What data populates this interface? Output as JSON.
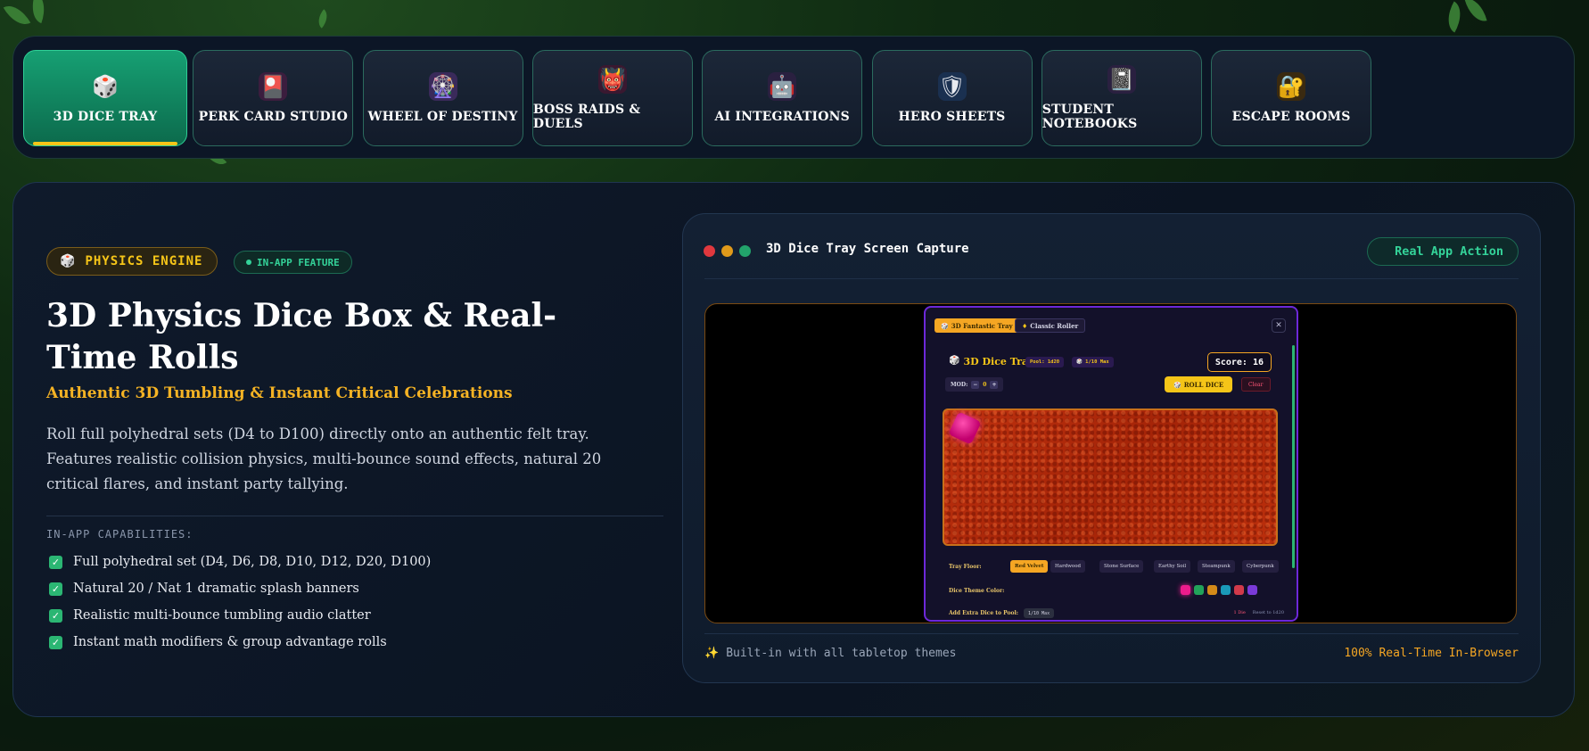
{
  "tabs": [
    {
      "label": "3D DICE TRAY",
      "icon": "dice-icon",
      "glyph": "🎲",
      "active": true
    },
    {
      "label": "PERK CARD STUDIO",
      "icon": "card-icon",
      "glyph": "🎴",
      "active": false
    },
    {
      "label": "WHEEL OF DESTINY",
      "icon": "wheel-icon",
      "glyph": "🎡",
      "active": false
    },
    {
      "label": "BOSS RAIDS & DUELS",
      "icon": "demon-icon",
      "glyph": "👹",
      "active": false
    },
    {
      "label": "AI INTEGRATIONS",
      "icon": "robot-icon",
      "glyph": "🤖",
      "active": false
    },
    {
      "label": "HERO SHEETS",
      "icon": "shield-icon",
      "glyph": "🛡",
      "active": false
    },
    {
      "label": "STUDENT NOTEBOOKS",
      "icon": "notebook-icon",
      "glyph": "📓",
      "active": false
    },
    {
      "label": "ESCAPE ROOMS",
      "icon": "padlock-icon",
      "glyph": "🔐",
      "active": false
    }
  ],
  "feature": {
    "badge_icon": "🎲",
    "badge": "PHYSICS ENGINE",
    "tag": "IN-APP FEATURE",
    "title": "3D Physics Dice Box & Real-Time Rolls",
    "subtitle": "Authentic 3D Tumbling & Instant Critical Celebrations",
    "description": "Roll full polyhedral sets (D4 to D100) directly onto an authentic felt tray. Features realistic collision physics, multi-bounce sound effects, natural 20 critical flares, and instant party tallying.",
    "capabilities_title": "IN-APP CAPABILITIES:",
    "capabilities": [
      "Full polyhedral set (D4, D6, D8, D10, D12, D20, D100)",
      "Natural 20 / Nat 1 dramatic splash banners",
      "Realistic multi-bounce tumbling audio clatter",
      "Instant math modifiers & group advantage rolls"
    ]
  },
  "capture": {
    "title": "3D Dice Tray Screen Capture",
    "live_label": "Real App Action",
    "footer_icon": "✨",
    "footer_left": "Built-in with all tabletop themes",
    "footer_right": "100% Real-Time In-Browser",
    "traffic_colors": [
      "#e0383e",
      "#e09a1a",
      "#22a36b"
    ]
  },
  "mini_app": {
    "tab_active": "3D Fantastic Tray",
    "tab_inactive": "Classic Roller",
    "tab_inactive_icon": "♦",
    "close": "✕",
    "header_icon": "🎲",
    "header": "3D Dice Tray",
    "chip_pool": "Pool: 1d20",
    "chip_max": "🎲 1/10 Max",
    "score": "Score: 16",
    "mod_label": "MOD:",
    "mod_minus": "−",
    "mod_value": "0",
    "mod_plus": "+",
    "roll": "ROLL DICE",
    "clear": "Clear",
    "floor_label": "Tray Floor:",
    "floors": [
      "Red Velvet",
      "Hardwood",
      "Stone Surface",
      "Earthy Soil",
      "Steampunk",
      "Cyberpunk"
    ],
    "theme_label": "Dice Theme Color:",
    "theme_colors": [
      "#ec1c8c",
      "#22a35a",
      "#d48a18",
      "#1a9ab8",
      "#d23a4a",
      "#7a3ad8"
    ],
    "extra_label": "Add Extra Dice to Pool:",
    "extra_chip": "1/10 Max",
    "link1": "1 Die",
    "link2": "Reset to 1d20"
  }
}
